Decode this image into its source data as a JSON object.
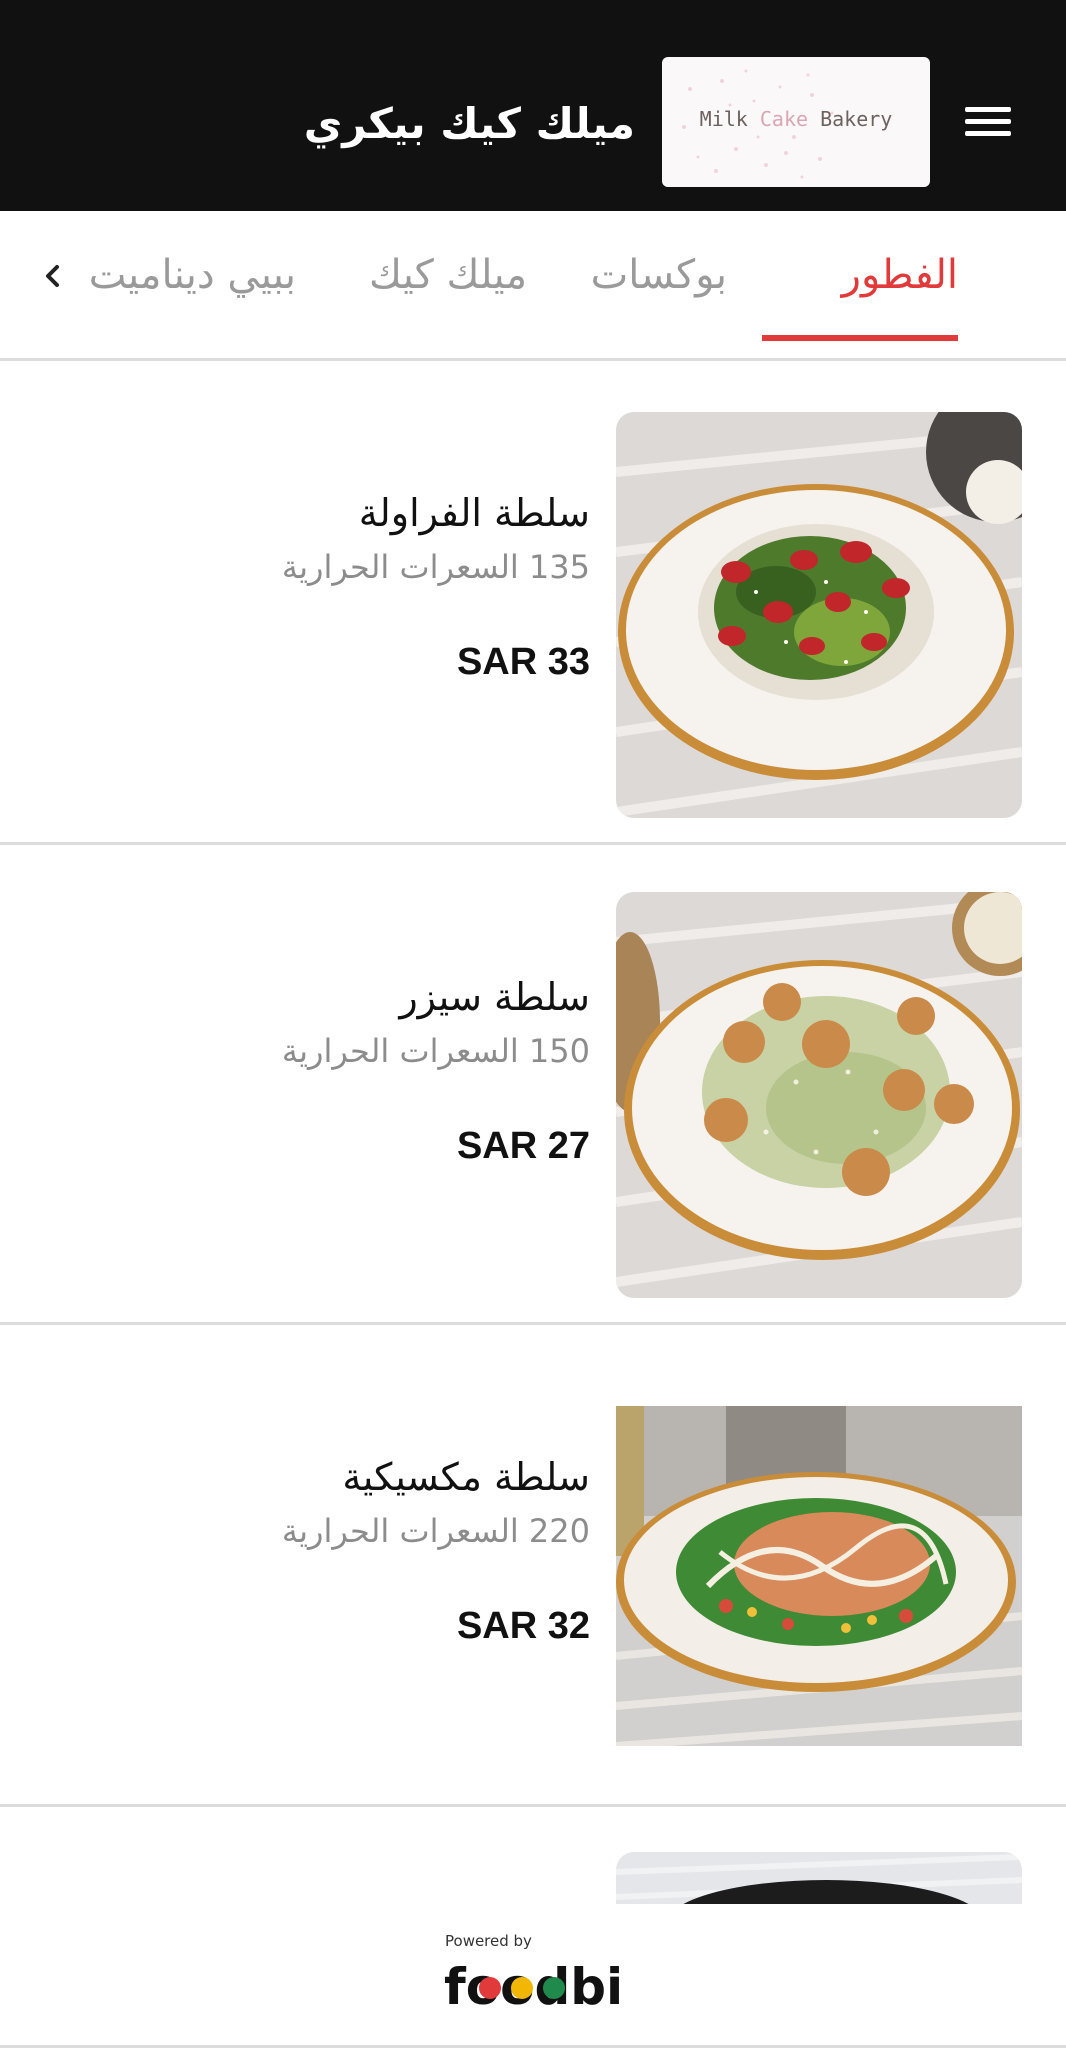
{
  "header": {
    "title": "ميلك كيك بيكري",
    "logo": {
      "word1": "Milk",
      "word2": "Cake",
      "word3": "Bakery"
    },
    "menu_icon": "hamburger-menu-icon"
  },
  "tabs": {
    "items": [
      {
        "label": "الفطور",
        "active": true
      },
      {
        "label": "بوكسات",
        "active": false
      },
      {
        "label": "ميلك كيك",
        "active": false
      },
      {
        "label": "ببيي ديناميت",
        "active": false
      }
    ],
    "scroll_icon": "chevron-left-icon"
  },
  "menu_items": [
    {
      "name": "سلطة الفراولة",
      "calories": "135 السعرات الحرارية",
      "price": "SAR 33"
    },
    {
      "name": "سلطة سيزر",
      "calories": "150 السعرات الحرارية",
      "price": "SAR 27"
    },
    {
      "name": "سلطة مكسيكية",
      "calories": "220 السعرات الحرارية",
      "price": "SAR 32"
    }
  ],
  "footer": {
    "powered_by": "Powered by",
    "brand": "foodbit"
  },
  "colors": {
    "header_bg": "#111111",
    "accent": "#e03a3a",
    "muted": "#8c8c8c",
    "divider": "#dcdcdc"
  }
}
